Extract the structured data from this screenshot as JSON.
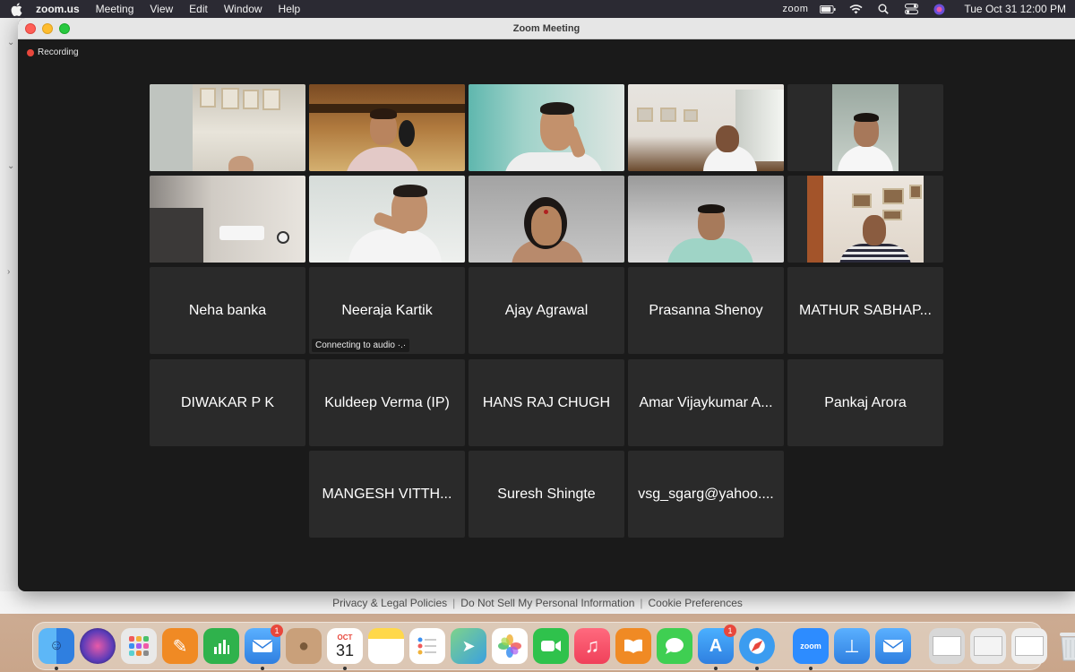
{
  "menubar": {
    "app_name": "zoom.us",
    "menus": [
      "Meeting",
      "View",
      "Edit",
      "Window",
      "Help"
    ],
    "zoom_status": "zoom",
    "datetime": "Tue Oct 31  12:00 PM"
  },
  "window": {
    "title": "Zoom Meeting",
    "recording_label": "Recording"
  },
  "background_page": {
    "footer_links": [
      "Privacy & Legal Policies",
      "Do Not Sell My Personal Information",
      "Cookie Preferences"
    ]
  },
  "participants": {
    "video_tiles": [
      {
        "id": "v1"
      },
      {
        "id": "v2"
      },
      {
        "id": "v3"
      },
      {
        "id": "v4"
      },
      {
        "id": "v5"
      },
      {
        "id": "v6"
      },
      {
        "id": "v7"
      },
      {
        "id": "v8",
        "active_speaker": true
      },
      {
        "id": "v9"
      },
      {
        "id": "v10"
      }
    ],
    "name_tiles": [
      {
        "name": "Neha banka"
      },
      {
        "name": "Neeraja Kartik",
        "status": "Connecting to audio  ·.·"
      },
      {
        "name": "Ajay Agrawal"
      },
      {
        "name": "Prasanna Shenoy"
      },
      {
        "name": "MATHUR SABHAP..."
      },
      {
        "name": "DIWAKAR P K"
      },
      {
        "name": "Kuldeep Verma (IP)"
      },
      {
        "name": "HANS RAJ CHUGH"
      },
      {
        "name": "Amar Vijaykumar A..."
      },
      {
        "name": "Pankaj Arora"
      },
      {
        "name": "MANGESH VITTH..."
      },
      {
        "name": "Suresh Shingte"
      },
      {
        "name": "vsg_sgarg@yahoo...."
      }
    ]
  },
  "dock": {
    "apps": [
      {
        "name": "finder-icon",
        "color": "#2f7fe0"
      },
      {
        "name": "siri-icon",
        "color": "#5a3bb8"
      },
      {
        "name": "launchpad-icon",
        "color": "#e9e9e9"
      },
      {
        "name": "pages-icon",
        "color": "#f08a24"
      },
      {
        "name": "numbers-icon",
        "color": "#2fb24c"
      },
      {
        "name": "mail-icon",
        "color": "#3b8ff0",
        "badge": "1"
      },
      {
        "name": "contacts-icon",
        "color": "#c9a07a"
      },
      {
        "name": "calendar-icon",
        "color": "#ffffff",
        "month": "OCT",
        "day": "31"
      },
      {
        "name": "notes-icon",
        "color": "#ffd84a"
      },
      {
        "name": "reminders-icon",
        "color": "#ffffff"
      },
      {
        "name": "maps-icon",
        "color": "#5ec26a"
      },
      {
        "name": "photos-icon",
        "color": "#ffffff"
      },
      {
        "name": "facetime-icon",
        "color": "#2fc24c"
      },
      {
        "name": "music-icon",
        "color": "#f0405a"
      },
      {
        "name": "books-icon",
        "color": "#f08a24"
      },
      {
        "name": "messages-icon",
        "color": "#3fcf52"
      },
      {
        "name": "app-store-icon",
        "color": "#2f8cf0",
        "badge": "1"
      },
      {
        "name": "safari-icon",
        "color": "#3b9cf0"
      }
    ],
    "recent": [
      {
        "name": "zoom-app-icon",
        "color": "#2d8cff",
        "label": "zoom"
      },
      {
        "name": "keynote-icon",
        "color": "#3c8ef0"
      },
      {
        "name": "mail-alt-icon",
        "color": "#3b8ff0"
      }
    ],
    "stack": [
      {
        "name": "downloads-stack-icon",
        "color": "#d8d8d8"
      },
      {
        "name": "documents-stack-icon",
        "color": "#e8e8e8"
      },
      {
        "name": "screenshots-stack-icon",
        "color": "#eeeeee"
      },
      {
        "name": "trash-icon",
        "color": "#cfd3d6"
      }
    ]
  }
}
